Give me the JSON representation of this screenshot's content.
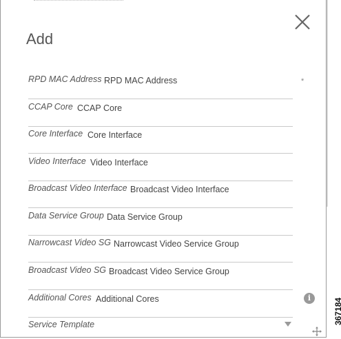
{
  "dialog": {
    "title": "Add",
    "fields": [
      {
        "label": "RPD MAC Address",
        "placeholder": "RPD MAC Address"
      },
      {
        "label": "CCAP Core",
        "placeholder": "CCAP Core"
      },
      {
        "label": "Core Interface",
        "placeholder": "Core Interface"
      },
      {
        "label": "Video Interface",
        "placeholder": "Video Interface"
      },
      {
        "label": "Broadcast Video Interface",
        "placeholder": "Broadcast Video Interface"
      },
      {
        "label": "Data Service Group",
        "placeholder": "Data Service Group"
      },
      {
        "label": "Narrowcast Video SG",
        "placeholder": "Narrowcast Video Service Group"
      },
      {
        "label": "Broadcast Video SG",
        "placeholder": "Broadcast Video Service Group"
      },
      {
        "label": "Additional Cores",
        "placeholder": "Additional Cores"
      },
      {
        "label": "Service Template",
        "placeholder": ""
      }
    ],
    "required_marker": "*",
    "info_icon_text": "i",
    "icons": {
      "close": "close-icon",
      "info": "info-icon",
      "dropdown": "chevron-down-icon",
      "move": "move-icon"
    }
  },
  "figure_id": "367184"
}
